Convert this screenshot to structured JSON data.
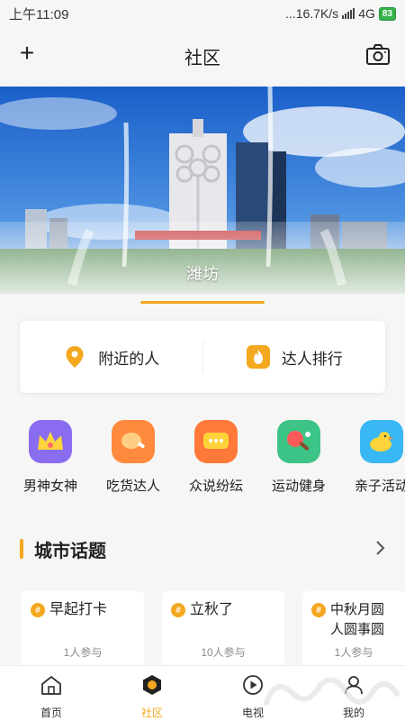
{
  "status": {
    "time": "上午11:09",
    "network": "...16.7K/s",
    "carrier": "4G",
    "battery": "83"
  },
  "header": {
    "title": "社区",
    "left_icon": "plus-icon",
    "right_icon": "camera-icon"
  },
  "banner": {
    "caption": "潍坊"
  },
  "quick": [
    {
      "label": "附近的人",
      "icon": "location-pin-icon"
    },
    {
      "label": "达人排行",
      "icon": "flame-icon"
    }
  ],
  "categories": [
    {
      "label": "男神女神",
      "icon": "crown-icon",
      "color": "#8a6cf0"
    },
    {
      "label": "吃货达人",
      "icon": "drumstick-icon",
      "color": "#ff8a3d"
    },
    {
      "label": "众说纷纭",
      "icon": "chat-bubble-icon",
      "color": "#ff7a3a"
    },
    {
      "label": "运动健身",
      "icon": "ping-pong-icon",
      "color": "#3cc486"
    },
    {
      "label": "亲子活动",
      "icon": "duck-icon",
      "color": "#39b7f4"
    }
  ],
  "section": {
    "title": "城市话题"
  },
  "topics": [
    {
      "title": "早起打卡",
      "count": "1人参与"
    },
    {
      "title": "立秋了",
      "count": "10人参与"
    },
    {
      "title": "中秋月圆人圆事圆",
      "count": "1人参与"
    }
  ],
  "tabs": [
    {
      "label": "首页",
      "icon": "home-icon"
    },
    {
      "label": "社区",
      "icon": "community-icon",
      "active": true
    },
    {
      "label": "电视",
      "icon": "tv-play-icon"
    },
    {
      "label": "我的",
      "icon": "profile-icon"
    }
  ],
  "colors": {
    "accent": "#f3a81f",
    "background": "#f6f6f6"
  }
}
